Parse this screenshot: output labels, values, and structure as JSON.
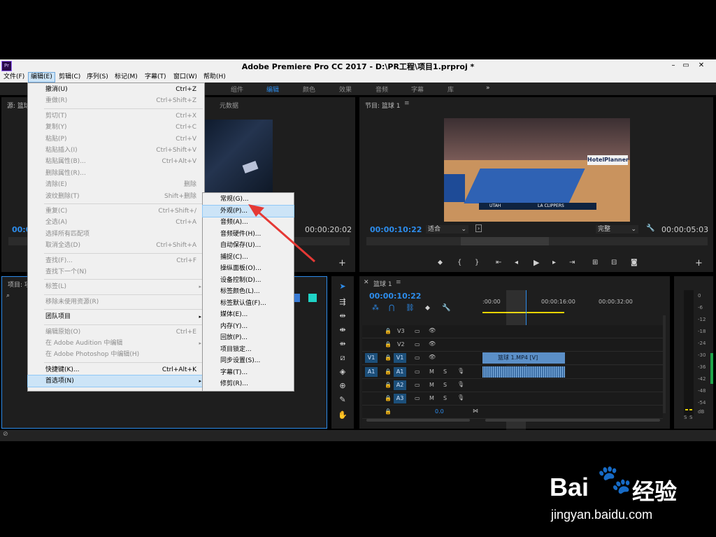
{
  "app": {
    "title": "Adobe Premiere Pro CC 2017 - D:\\PR工程\\项目1.prproj *",
    "logo": "Pr",
    "window_buttons": [
      "–",
      "▭",
      "✕"
    ]
  },
  "menubar": [
    "文件(F)",
    "编辑(E)",
    "剪辑(C)",
    "序列(S)",
    "标记(M)",
    "字幕(T)",
    "窗口(W)",
    "帮助(H)"
  ],
  "workspaces": [
    "组件",
    "编辑",
    "颜色",
    "效果",
    "音频",
    "字幕",
    "库",
    "»"
  ],
  "source_panel": {
    "tab": "源: 篮球",
    "tab2": "元数据",
    "timecode": "00:0",
    "timecode_right": "00:00:20:02"
  },
  "program_panel": {
    "tab": "节目: 篮球 1",
    "timecode": "00:00:10:22",
    "fit": "适合",
    "quality": "完整",
    "duration": "00:00:05:03",
    "scoreboard": {
      "team1": "UTAH",
      "team2": "LA CLIPPERS",
      "court_text": "HotelPlanner"
    }
  },
  "project_panel": {
    "tab": "项目: 项"
  },
  "timeline": {
    "tab": "篮球 1",
    "timecode": "00:00:10:22",
    "ruler": [
      ":00:00",
      "00:00:16:00",
      "00:00:32:00"
    ],
    "tracks_video": [
      "V3",
      "V2",
      "V1"
    ],
    "tracks_audio": [
      "A1",
      "A2",
      "A3"
    ],
    "source_v": "V1",
    "source_a": "A1",
    "clip_label": "篮球 1.MP4 [V]",
    "master_val": "0.0",
    "mute": "M",
    "solo": "S"
  },
  "meter": {
    "labels": [
      "0",
      "-6",
      "-12",
      "-18",
      "-24",
      "-30",
      "-36",
      "-42",
      "-48",
      "-54",
      "dB"
    ],
    "bottom": [
      "S",
      "S"
    ]
  },
  "edit_menu": [
    {
      "label": "撤消(U)",
      "shortcut": "Ctrl+Z",
      "enabled": true
    },
    {
      "label": "重做(R)",
      "shortcut": "Ctrl+Shift+Z",
      "enabled": false
    },
    {
      "sep": true
    },
    {
      "label": "剪切(T)",
      "shortcut": "Ctrl+X",
      "enabled": false
    },
    {
      "label": "复制(Y)",
      "shortcut": "Ctrl+C",
      "enabled": false
    },
    {
      "label": "粘贴(P)",
      "shortcut": "Ctrl+V",
      "enabled": false
    },
    {
      "label": "粘贴插入(I)",
      "shortcut": "Ctrl+Shift+V",
      "enabled": false
    },
    {
      "label": "粘贴属性(B)...",
      "shortcut": "Ctrl+Alt+V",
      "enabled": false
    },
    {
      "label": "删除属性(R)...",
      "shortcut": "",
      "enabled": false
    },
    {
      "label": "清除(E)",
      "shortcut": "删除",
      "enabled": false
    },
    {
      "label": "波纹删除(T)",
      "shortcut": "Shift+删除",
      "enabled": false
    },
    {
      "sep": true
    },
    {
      "label": "重复(C)",
      "shortcut": "Ctrl+Shift+/",
      "enabled": false
    },
    {
      "label": "全选(A)",
      "shortcut": "Ctrl+A",
      "enabled": false
    },
    {
      "label": "选择所有匹配项",
      "shortcut": "",
      "enabled": false
    },
    {
      "label": "取消全选(D)",
      "shortcut": "Ctrl+Shift+A",
      "enabled": false
    },
    {
      "sep": true
    },
    {
      "label": "查找(F)...",
      "shortcut": "Ctrl+F",
      "enabled": false
    },
    {
      "label": "查找下一个(N)",
      "shortcut": "",
      "enabled": false
    },
    {
      "sep": true
    },
    {
      "label": "标签(L)",
      "shortcut": "",
      "enabled": false,
      "arrow": true
    },
    {
      "sep": true
    },
    {
      "label": "移除未使用资源(R)",
      "shortcut": "",
      "enabled": false
    },
    {
      "sep": true
    },
    {
      "label": "团队项目",
      "shortcut": "",
      "enabled": true,
      "arrow": true
    },
    {
      "sep": true
    },
    {
      "label": "编辑原始(O)",
      "shortcut": "Ctrl+E",
      "enabled": false
    },
    {
      "label": "在 Adobe Audition 中编辑",
      "shortcut": "",
      "enabled": false,
      "arrow": true
    },
    {
      "label": "在 Adobe Photoshop 中编辑(H)",
      "shortcut": "",
      "enabled": false
    },
    {
      "sep": true
    },
    {
      "label": "快捷键(K)...",
      "shortcut": "Ctrl+Alt+K",
      "enabled": true
    },
    {
      "label": "首选项(N)",
      "shortcut": "",
      "enabled": true,
      "arrow": true,
      "highlight": true
    }
  ],
  "prefs_submenu": [
    {
      "label": "常规(G)...",
      "highlight": false
    },
    {
      "label": "外观(P)...",
      "highlight": true
    },
    {
      "label": "音频(A)...",
      "highlight": false
    },
    {
      "label": "音频硬件(H)...",
      "highlight": false
    },
    {
      "label": "自动保存(U)...",
      "highlight": false
    },
    {
      "label": "捕捉(C)...",
      "highlight": false
    },
    {
      "label": "操纵面板(O)...",
      "highlight": false
    },
    {
      "label": "设备控制(D)...",
      "highlight": false
    },
    {
      "label": "标签颜色(L)...",
      "highlight": false
    },
    {
      "label": "标签默认值(F)...",
      "highlight": false
    },
    {
      "label": "媒体(E)...",
      "highlight": false
    },
    {
      "label": "内存(Y)...",
      "highlight": false
    },
    {
      "label": "回放(P)...",
      "highlight": false
    },
    {
      "label": "项目锁定...",
      "highlight": false
    },
    {
      "label": "同步设置(S)...",
      "highlight": false
    },
    {
      "label": "字幕(T)...",
      "highlight": false
    },
    {
      "label": "修剪(R)...",
      "highlight": false
    }
  ],
  "watermark": {
    "brand_a": "Bai",
    "brand_b": "经验",
    "url": "jingyan.baidu.com"
  },
  "colors": {
    "accent": "#2d8ceb",
    "annotation_arrow": "#e53935",
    "menu_bg": "#f0f0f0",
    "menu_highlight": "#cce4f7",
    "clip_video": "#5b8fc7",
    "clip_audio": "#3d6fa6"
  }
}
